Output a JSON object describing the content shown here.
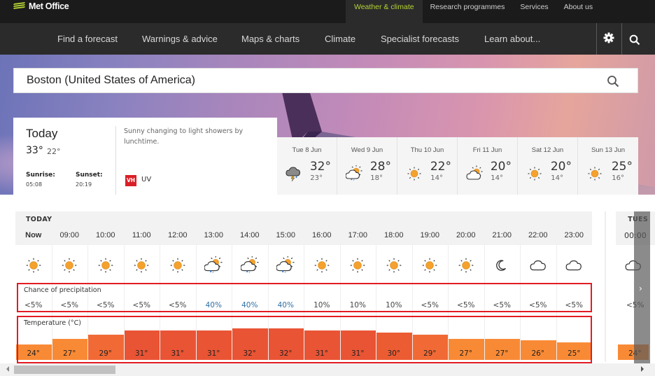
{
  "brand": {
    "name": "Met Office",
    "accent": "#b4d334"
  },
  "toplinks": [
    {
      "label": "Weather & climate",
      "active": true
    },
    {
      "label": "Research programmes",
      "active": false
    },
    {
      "label": "Services",
      "active": false
    },
    {
      "label": "About us",
      "active": false
    }
  ],
  "nav": [
    {
      "label": "Find a forecast"
    },
    {
      "label": "Warnings & advice"
    },
    {
      "label": "Maps & charts"
    },
    {
      "label": "Climate"
    },
    {
      "label": "Specialist forecasts"
    },
    {
      "label": "Learn about..."
    }
  ],
  "nav_icons": {
    "settings": "gear-icon",
    "search": "search-icon"
  },
  "search": {
    "value": "Boston (United States of America)",
    "icon": "search-icon"
  },
  "today": {
    "title": "Today",
    "high": "33°",
    "low": "22°",
    "sunrise_label": "Sunrise:",
    "sunrise": "05:08",
    "sunset_label": "Sunset:",
    "sunset": "20:19",
    "description": "Sunny changing to light showers by lunchtime.",
    "uv_badge": "VH",
    "uv_label": "UV",
    "uv_color": "#d91f26"
  },
  "days": [
    {
      "name": "Tue 8 Jun",
      "icon": "thunder-shower",
      "high": "32°",
      "low": "23°"
    },
    {
      "name": "Wed 9 Jun",
      "icon": "sun-cloud-rain",
      "high": "28°",
      "low": "18°"
    },
    {
      "name": "Thu 10 Jun",
      "icon": "sun",
      "high": "22°",
      "low": "14°"
    },
    {
      "name": "Fri 11 Jun",
      "icon": "sun-cloud",
      "high": "20°",
      "low": "14°"
    },
    {
      "name": "Sat 12 Jun",
      "icon": "sun",
      "high": "20°",
      "low": "14°"
    },
    {
      "name": "Sun 13 Jun",
      "icon": "sun",
      "high": "25°",
      "low": "16°"
    }
  ],
  "hourly": {
    "day_label": "TODAY",
    "precip_label": "Chance of precipitation",
    "temp_label": "Temperature (°C)",
    "hours": [
      {
        "time": "Now",
        "icon": "sun",
        "precip": "<5%",
        "temp": "24°",
        "t": 24
      },
      {
        "time": "09:00",
        "icon": "sun",
        "precip": "<5%",
        "temp": "27°",
        "t": 27
      },
      {
        "time": "10:00",
        "icon": "sun",
        "precip": "<5%",
        "temp": "29°",
        "t": 29
      },
      {
        "time": "11:00",
        "icon": "sun",
        "precip": "<5%",
        "temp": "31°",
        "t": 31
      },
      {
        "time": "12:00",
        "icon": "sun",
        "precip": "<5%",
        "temp": "31°",
        "t": 31
      },
      {
        "time": "13:00",
        "icon": "sun-cloud-rain",
        "precip": "40%",
        "temp": "31°",
        "t": 31
      },
      {
        "time": "14:00",
        "icon": "sun-cloud-rain",
        "precip": "40%",
        "temp": "32°",
        "t": 32
      },
      {
        "time": "15:00",
        "icon": "sun-cloud-rain",
        "precip": "40%",
        "temp": "32°",
        "t": 32
      },
      {
        "time": "16:00",
        "icon": "sun",
        "precip": "10%",
        "temp": "31°",
        "t": 31
      },
      {
        "time": "17:00",
        "icon": "sun",
        "precip": "10%",
        "temp": "31°",
        "t": 31
      },
      {
        "time": "18:00",
        "icon": "sun",
        "precip": "10%",
        "temp": "30°",
        "t": 30
      },
      {
        "time": "19:00",
        "icon": "sun",
        "precip": "<5%",
        "temp": "29°",
        "t": 29
      },
      {
        "time": "20:00",
        "icon": "sun",
        "precip": "<5%",
        "temp": "27°",
        "t": 27
      },
      {
        "time": "21:00",
        "icon": "moon",
        "precip": "<5%",
        "temp": "27°",
        "t": 27
      },
      {
        "time": "22:00",
        "icon": "cloud",
        "precip": "<5%",
        "temp": "26°",
        "t": 26
      },
      {
        "time": "23:00",
        "icon": "cloud",
        "precip": "<5%",
        "temp": "25°",
        "t": 25
      }
    ],
    "next": {
      "day_label": "TUES",
      "time": "00:00",
      "icon": "cloud",
      "precip": "<5%",
      "temp": "24°",
      "t": 24
    }
  },
  "colors": {
    "precip_highlight": "#2f6fa3",
    "highlight_box": "#e41b23"
  }
}
